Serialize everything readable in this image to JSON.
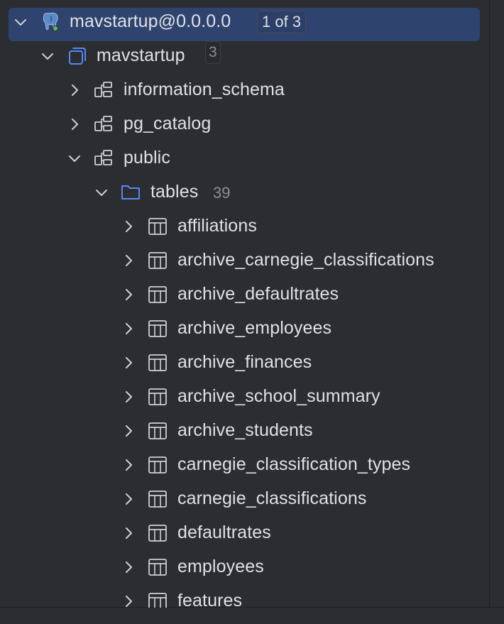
{
  "connection": {
    "label": "mavstartup@0.0.0.0",
    "badge": "1 of 3",
    "icon": "postgres-elephant-icon"
  },
  "database": {
    "label": "mavstartup",
    "badge": "3",
    "icon": "database-icon"
  },
  "schemas": [
    {
      "label": "information_schema",
      "icon": "schema-icon"
    },
    {
      "label": "pg_catalog",
      "icon": "schema-icon"
    },
    {
      "label": "public",
      "icon": "schema-icon"
    }
  ],
  "tables_folder": {
    "label": "tables",
    "count": "39",
    "icon": "folder-icon"
  },
  "tables": [
    "affiliations",
    "archive_carnegie_classifications",
    "archive_defaultrates",
    "archive_employees",
    "archive_finances",
    "archive_school_summary",
    "archive_students",
    "carnegie_classification_types",
    "carnegie_classifications",
    "defaultrates",
    "employees",
    "features"
  ],
  "colors": {
    "background": "#2b2d30",
    "selection": "#2e436e",
    "text": "#dfe1e5",
    "muted": "#8c8f96",
    "accent_blue": "#548af7",
    "status_green": "#5fb865"
  }
}
